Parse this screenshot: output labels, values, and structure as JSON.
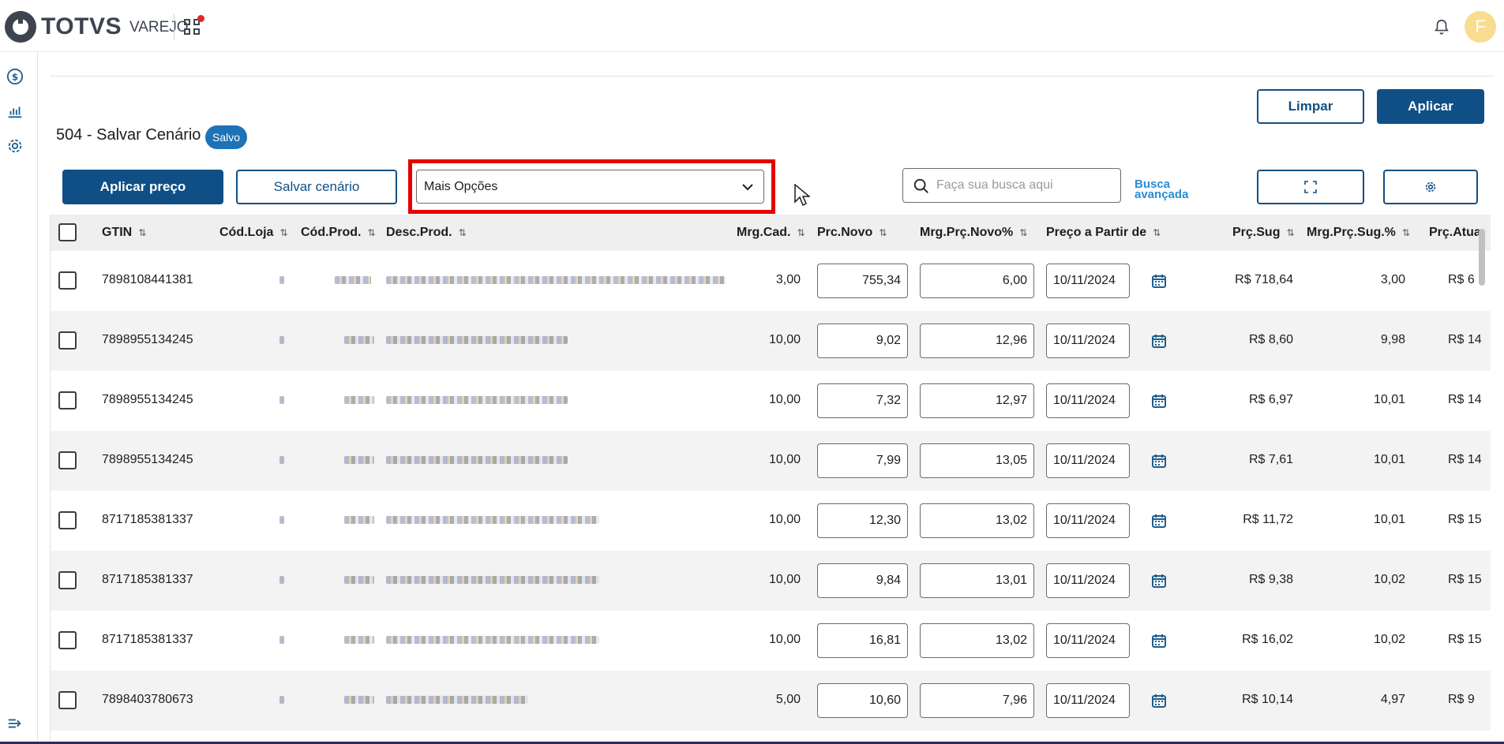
{
  "app": {
    "brand": "TOTVS",
    "module": "VAREJO",
    "avatar_initial": "F"
  },
  "page": {
    "title": "504 - Salvar Cenário",
    "status_badge": "Salvo"
  },
  "actions": {
    "clear": "Limpar",
    "apply": "Aplicar",
    "apply_price": "Aplicar preço",
    "save_scenario": "Salvar cenário",
    "more_options": "Mais Opções",
    "search_placeholder": "Faça sua busca aqui",
    "advanced_search_line1": "Busca",
    "advanced_search_line2": "avançada"
  },
  "columns": [
    "GTIN",
    "Cód.Loja",
    "Cód.Prod.",
    "Desc.Prod.",
    "Mrg.Cad.",
    "Prc.Novo",
    "Mrg.Prç.Novo%",
    "Preço a Partir de",
    "Prç.Sug",
    "Mrg.Prç.Sug.%",
    "Prç.Atua"
  ],
  "rows": [
    {
      "gtin": "7898108441381",
      "mrg_cad": "3,00",
      "prc_novo": "755,34",
      "mrg_novo": "6,00",
      "data": "10/11/2024",
      "prc_sug": "R$ 718,64",
      "mrg_sug": "3,00",
      "prc_atual": "R$ 6"
    },
    {
      "gtin": "7898955134245",
      "mrg_cad": "10,00",
      "prc_novo": "9,02",
      "mrg_novo": "12,96",
      "data": "10/11/2024",
      "prc_sug": "R$ 8,60",
      "mrg_sug": "9,98",
      "prc_atual": "R$ 14"
    },
    {
      "gtin": "7898955134245",
      "mrg_cad": "10,00",
      "prc_novo": "7,32",
      "mrg_novo": "12,97",
      "data": "10/11/2024",
      "prc_sug": "R$ 6,97",
      "mrg_sug": "10,01",
      "prc_atual": "R$ 14"
    },
    {
      "gtin": "7898955134245",
      "mrg_cad": "10,00",
      "prc_novo": "7,99",
      "mrg_novo": "13,05",
      "data": "10/11/2024",
      "prc_sug": "R$ 7,61",
      "mrg_sug": "10,01",
      "prc_atual": "R$ 14"
    },
    {
      "gtin": "8717185381337",
      "mrg_cad": "10,00",
      "prc_novo": "12,30",
      "mrg_novo": "13,02",
      "data": "10/11/2024",
      "prc_sug": "R$ 11,72",
      "mrg_sug": "10,01",
      "prc_atual": "R$ 15"
    },
    {
      "gtin": "8717185381337",
      "mrg_cad": "10,00",
      "prc_novo": "9,84",
      "mrg_novo": "13,01",
      "data": "10/11/2024",
      "prc_sug": "R$ 9,38",
      "mrg_sug": "10,02",
      "prc_atual": "R$ 15"
    },
    {
      "gtin": "8717185381337",
      "mrg_cad": "10,00",
      "prc_novo": "16,81",
      "mrg_novo": "13,02",
      "data": "10/11/2024",
      "prc_sug": "R$ 16,02",
      "mrg_sug": "10,02",
      "prc_atual": "R$ 15"
    },
    {
      "gtin": "7898403780673",
      "mrg_cad": "5,00",
      "prc_novo": "10,60",
      "mrg_novo": "7,96",
      "data": "10/11/2024",
      "prc_sug": "R$ 10,14",
      "mrg_sug": "4,97",
      "prc_atual": "R$ 9"
    }
  ]
}
